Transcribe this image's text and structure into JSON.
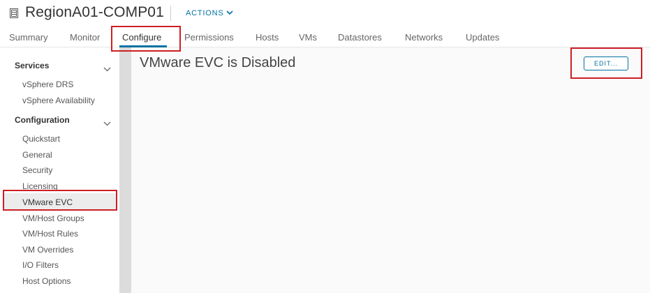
{
  "header": {
    "object_icon": "cluster-icon",
    "title": "RegionA01-COMP01",
    "actions_label": "ACTIONS"
  },
  "tabs": [
    {
      "label": "Summary",
      "active": false
    },
    {
      "label": "Monitor",
      "active": false
    },
    {
      "label": "Configure",
      "active": true
    },
    {
      "label": "Permissions",
      "active": false
    },
    {
      "label": "Hosts",
      "active": false
    },
    {
      "label": "VMs",
      "active": false
    },
    {
      "label": "Datastores",
      "active": false
    },
    {
      "label": "Networks",
      "active": false
    },
    {
      "label": "Updates",
      "active": false
    }
  ],
  "sidebar": {
    "sections": [
      {
        "label": "Services",
        "items": [
          "vSphere DRS",
          "vSphere Availability"
        ]
      },
      {
        "label": "Configuration",
        "items": [
          "Quickstart",
          "General",
          "Security",
          "Licensing",
          "VMware EVC",
          "VM/Host Groups",
          "VM/Host Rules",
          "VM Overrides",
          "I/O Filters",
          "Host Options"
        ]
      }
    ],
    "selected_item": "VMware EVC"
  },
  "main": {
    "heading": "VMware EVC is Disabled",
    "edit_label": "EDIT..."
  },
  "colors": {
    "accent": "#0072a3",
    "highlight_box": "#cc1f24",
    "main_bg": "#fafafa",
    "scrollbar": "#dcdcdc"
  }
}
